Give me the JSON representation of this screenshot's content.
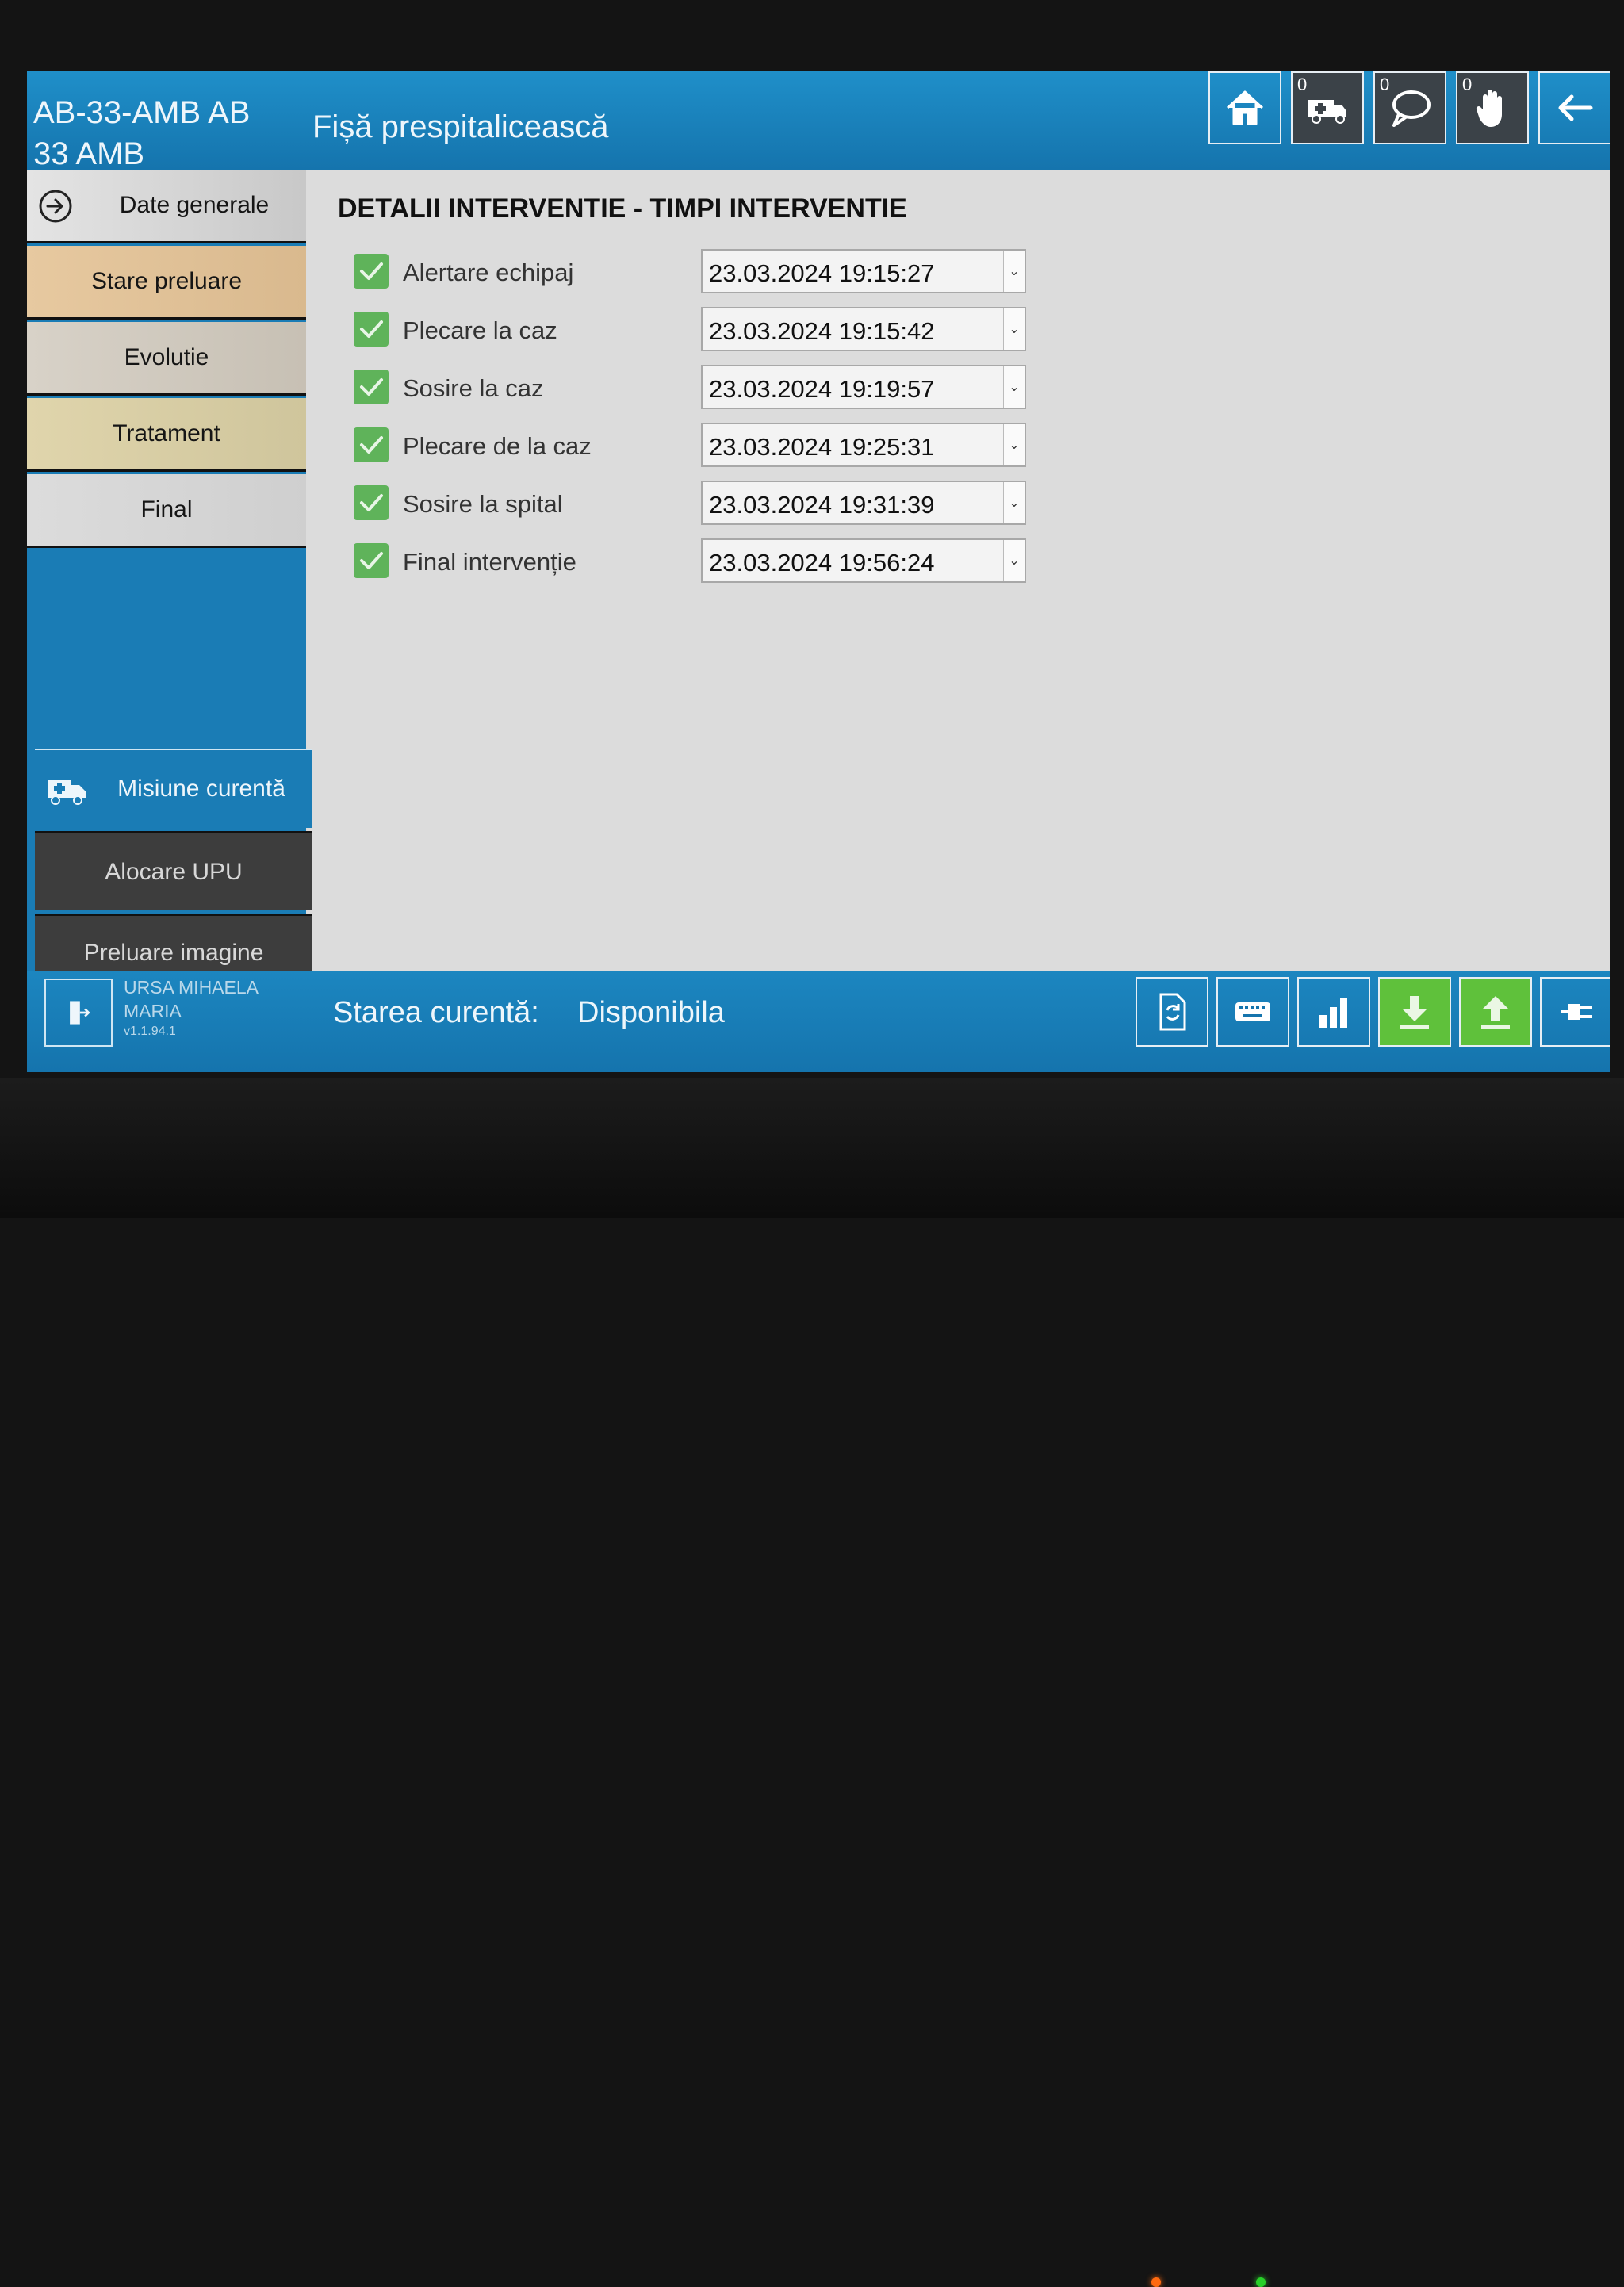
{
  "header": {
    "unit_id": "AB-33-AMB  AB\n33 AMB",
    "title": "Fișă prespitalicească",
    "badges": {
      "ambulance": "0",
      "messages": "0",
      "hand": "0"
    },
    "icons": [
      "home-icon",
      "ambulance-icon",
      "chat-bubble-icon",
      "hand-icon",
      "back-arrow-icon"
    ]
  },
  "sidebar": {
    "items": [
      {
        "label": "Date generale",
        "icon": "arrow-circle-right-icon",
        "active": true
      },
      {
        "label": "Stare preluare"
      },
      {
        "label": "Evolutie"
      },
      {
        "label": "Tratament"
      },
      {
        "label": "Final"
      }
    ],
    "mission_button": "Misiune curentă",
    "upu_button": "Alocare UPU",
    "image_button": "Preluare imagine"
  },
  "content": {
    "section_title": "DETALII INTERVENTIE - TIMPI INTERVENTIE",
    "rows": [
      {
        "label": "Alertare echipaj",
        "value": "23.03.2024 19:15:27",
        "checked": true
      },
      {
        "label": "Plecare la caz",
        "value": "23.03.2024 19:15:42",
        "checked": true
      },
      {
        "label": "Sosire la caz",
        "value": "23.03.2024 19:19:57",
        "checked": true
      },
      {
        "label": "Plecare de la caz",
        "value": "23.03.2024 19:25:31",
        "checked": true
      },
      {
        "label": "Sosire la spital",
        "value": "23.03.2024 19:31:39",
        "checked": true
      },
      {
        "label": "Final intervenție",
        "value": "23.03.2024 19:56:24",
        "checked": true
      }
    ]
  },
  "footer": {
    "user": "URSA MIHAELA\nMARIA",
    "version": "v1.1.94.1",
    "state_label": "Starea curentă:",
    "state_value": "Disponibila",
    "icons": [
      "document-sync-icon",
      "keyboard-icon",
      "bar-chart-icon",
      "download-icon",
      "upload-icon",
      "plug-icon"
    ]
  },
  "colors": {
    "header_blue": "#1f8fc9",
    "check_green": "#5fb35a",
    "action_green": "#5fc13b",
    "dark_button": "#3d3d3d"
  }
}
